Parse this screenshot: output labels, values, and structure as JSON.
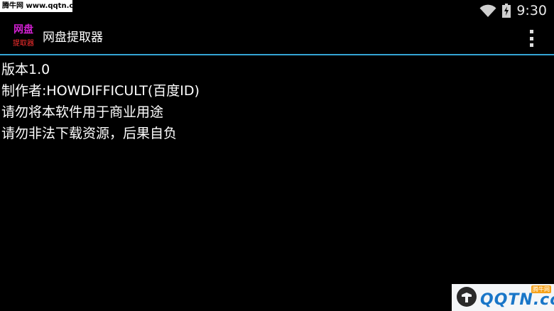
{
  "watermark_top": "腾牛网 www.qqtn.com",
  "status": {
    "time": "9:30",
    "icons": [
      "wifi-icon",
      "battery-charging-icon"
    ]
  },
  "action_bar": {
    "icon": {
      "line1": "网盘",
      "line2": "提取器"
    },
    "title": "网盘提取器",
    "menu_icon": "overflow-menu-icon"
  },
  "content": {
    "lines": [
      "版本1.0",
      "制作者:HOWDIFFICULT(百度ID)",
      "请勿将本软件用于商业用途",
      "请勿非法下载资源，后果自负"
    ]
  },
  "watermark_bottom": {
    "text": "QQTN.com",
    "tag": "腾牛网"
  },
  "colors": {
    "background": "#000000",
    "divider": "#34a4d4",
    "icon_line1": "#d020d0",
    "icon_line2": "#ff3030",
    "watermark_text": "#1976c8"
  }
}
